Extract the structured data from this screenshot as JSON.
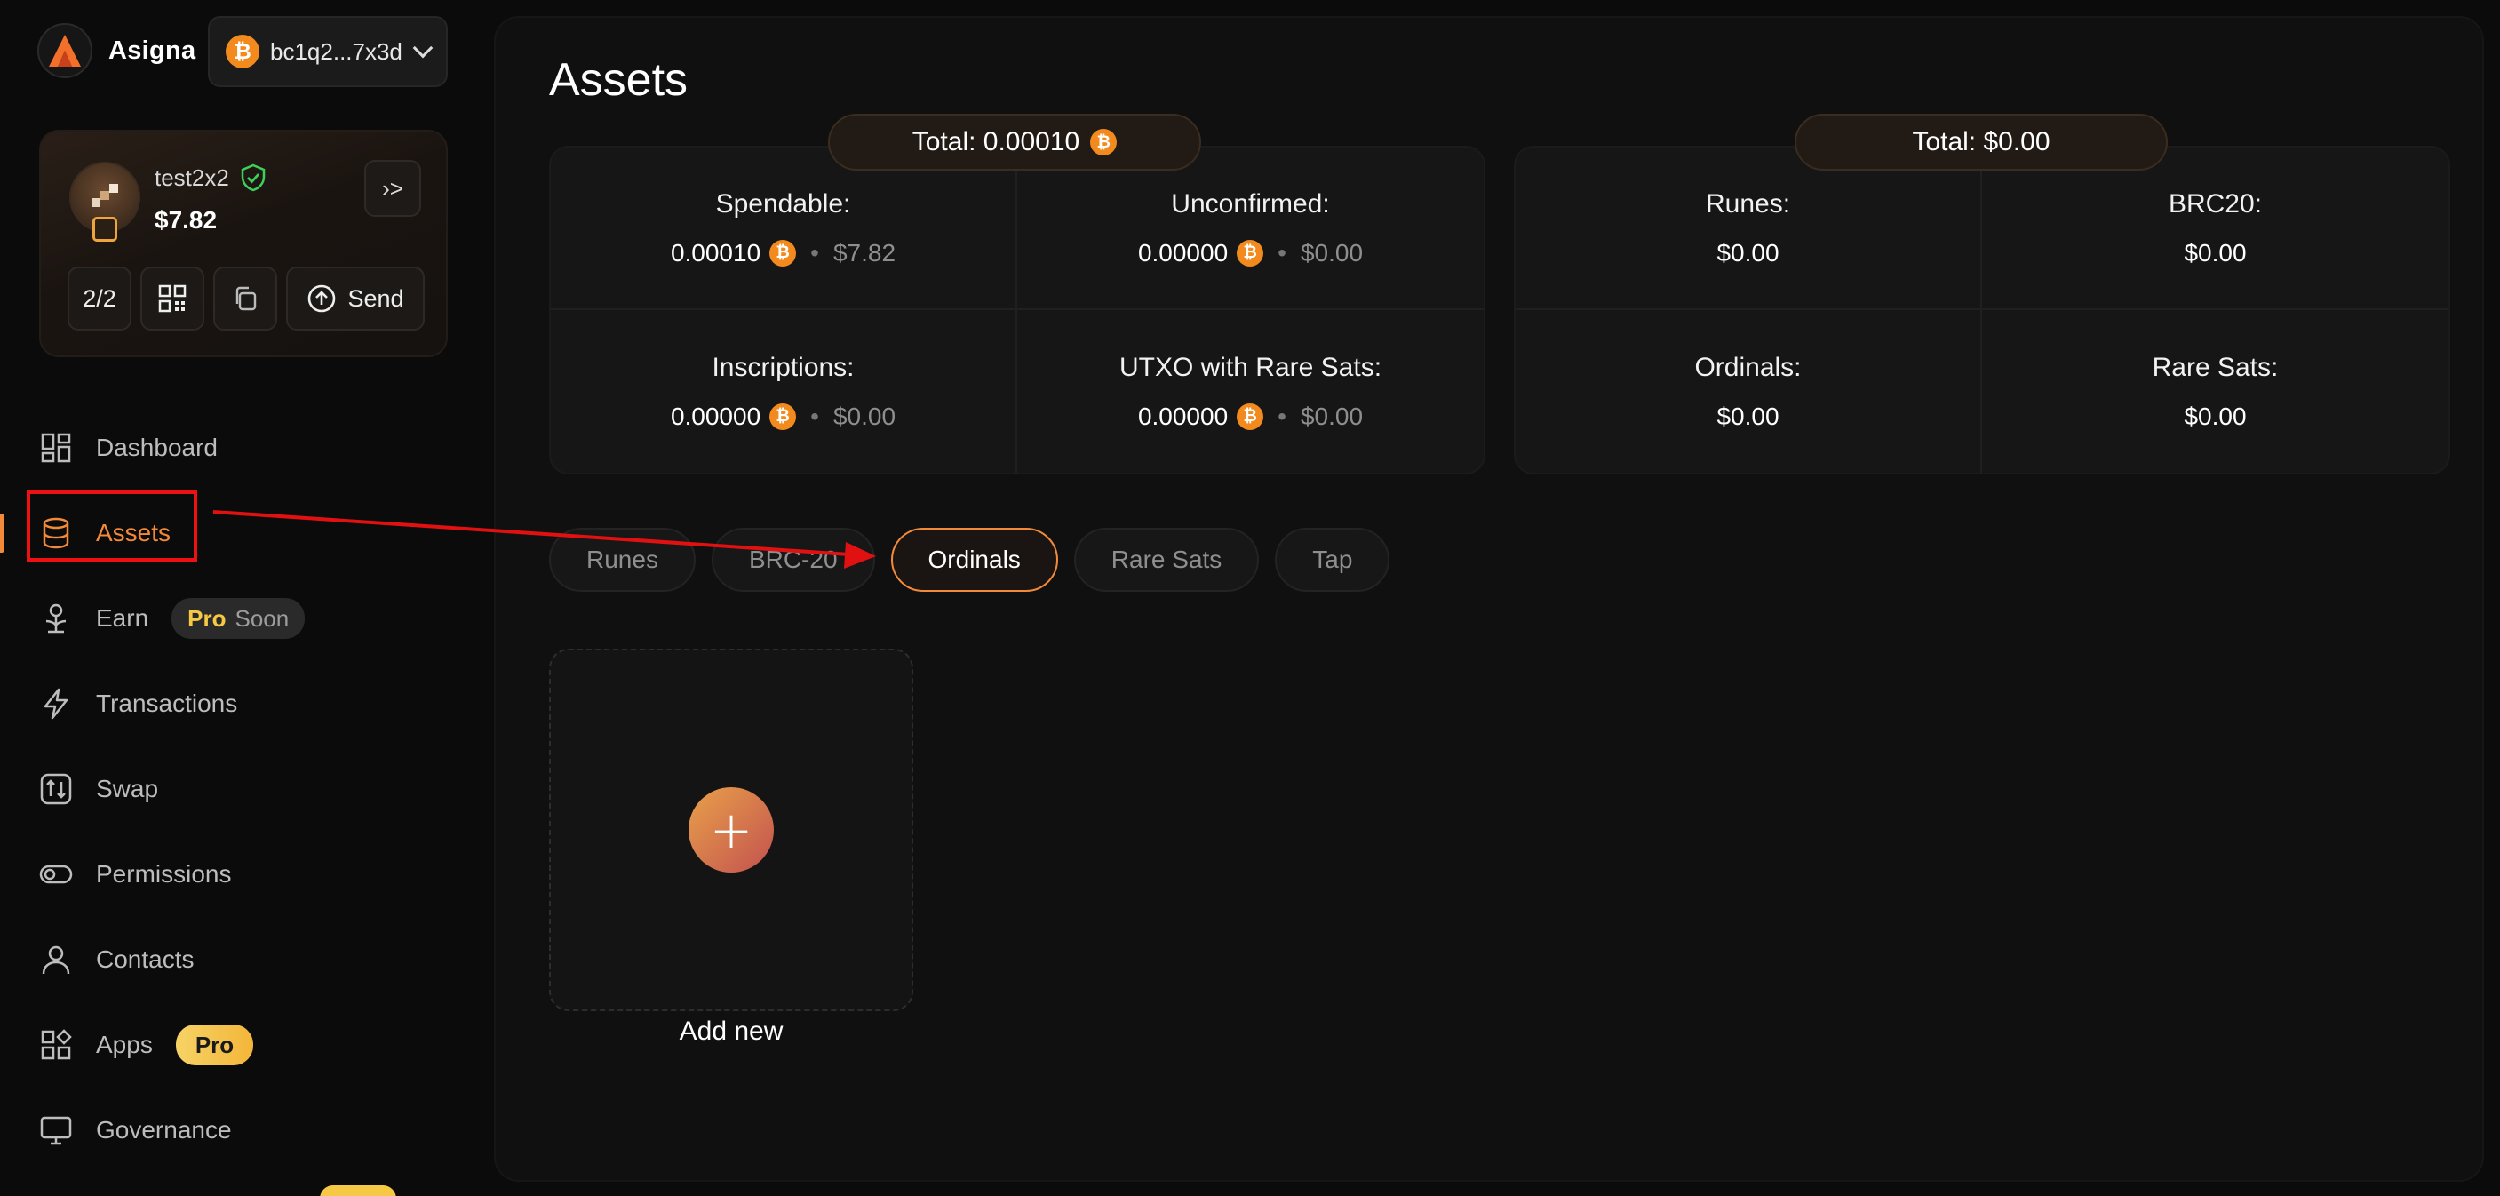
{
  "app": {
    "name": "Asigna"
  },
  "address": {
    "short": "bc1q2...7x3d",
    "btc_symbol": "₿"
  },
  "wallet": {
    "name": "test2x2",
    "balance": "$7.82",
    "signers": "2/2",
    "send_label": "Send",
    "expand_glyph": "›>"
  },
  "nav": {
    "dashboard": "Dashboard",
    "assets": "Assets",
    "earn": "Earn",
    "earn_badge_pro": "Pro",
    "earn_badge_soon": "Soon",
    "transactions": "Transactions",
    "swap": "Swap",
    "permissions": "Permissions",
    "contacts": "Contacts",
    "apps": "Apps",
    "apps_badge": "Pro",
    "governance": "Governance"
  },
  "main": {
    "title": "Assets",
    "left_total": "Total: 0.00010",
    "right_total": "Total: $0.00",
    "left_cells": [
      {
        "label": "Spendable:",
        "btc": "0.00010",
        "usd": "$7.82"
      },
      {
        "label": "Unconfirmed:",
        "btc": "0.00000",
        "usd": "$0.00"
      },
      {
        "label": "Inscriptions:",
        "btc": "0.00000",
        "usd": "$0.00"
      },
      {
        "label": "UTXO with Rare Sats:",
        "btc": "0.00000",
        "usd": "$0.00"
      }
    ],
    "right_cells": [
      {
        "label": "Runes:",
        "usd": "$0.00"
      },
      {
        "label": "BRC20:",
        "usd": "$0.00"
      },
      {
        "label": "Ordinals:",
        "usd": "$0.00"
      },
      {
        "label": "Rare Sats:",
        "usd": "$0.00"
      }
    ],
    "tabs": [
      "Runes",
      "BRC-20",
      "Ordinals",
      "Rare Sats",
      "Tap"
    ],
    "active_tab": "Ordinals",
    "add_new": "Add new",
    "add_glyph": "+"
  },
  "colors": {
    "accent": "#f28a3a",
    "bitcoin": "#f28a1e",
    "pro": "#f6c945",
    "verified": "#3ecf5a",
    "annotation": "#e11111"
  }
}
